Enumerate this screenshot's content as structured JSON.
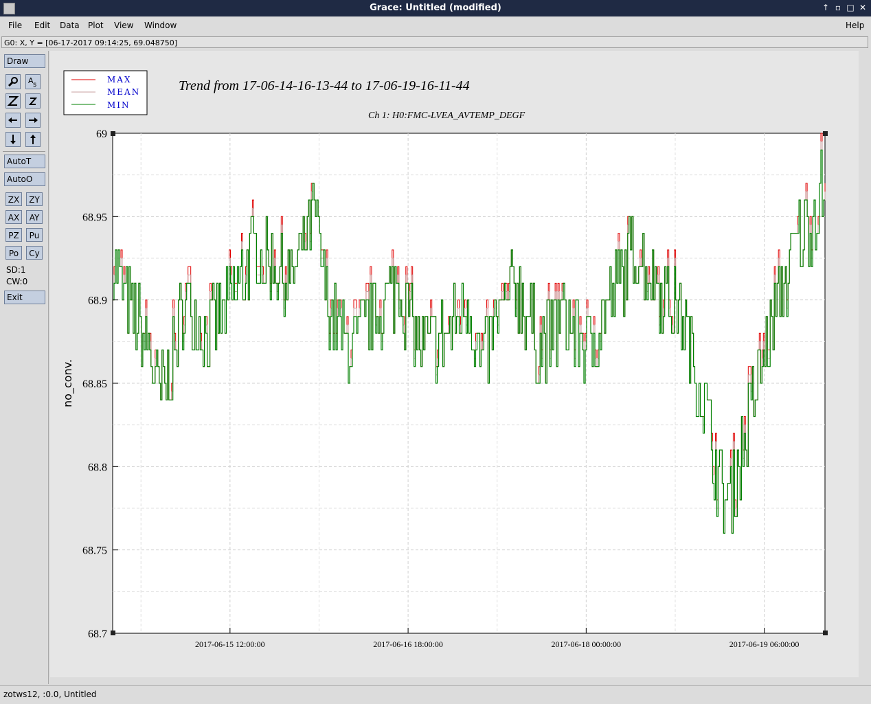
{
  "window": {
    "title": "Grace: Untitled (modified)",
    "controls": [
      "↑",
      "▫",
      "□",
      "✕"
    ]
  },
  "menubar": {
    "file": "File",
    "edit": "Edit",
    "data": "Data",
    "plot": "Plot",
    "view": "View",
    "window": "Window",
    "help": "Help"
  },
  "coord_readout": "G0: X, Y = [06-17-2017 09:14:25, 69.048750]",
  "toolbar": {
    "draw": "Draw",
    "zoom_icon": "magnifier-icon",
    "text_icon": "text-icon",
    "autoT": "AutoT",
    "autoO": "AutoO",
    "zx": "ZX",
    "zy": "ZY",
    "ax": "AX",
    "ay": "AY",
    "pz": "PZ",
    "pu": "Pu",
    "po": "Po",
    "cy": "Cy",
    "sd": "SD:1",
    "cw": "CW:0",
    "exit": "Exit"
  },
  "status": "zotws12, :0.0, Untitled",
  "chart_data": {
    "type": "line",
    "title": "Trend from 17-06-14-16-13-44 to 17-06-19-16-11-44",
    "subtitle": "Ch 1: H0:FMC-LVEA_AVTEMP_DEGF",
    "ylabel": "no_conv.",
    "xlabel": "",
    "ylim": [
      68.7,
      69.0
    ],
    "yticks": [
      "68.7",
      "68.75",
      "68.8",
      "68.85",
      "68.9",
      "68.95",
      "69"
    ],
    "xticks": [
      "2017-06-15 12:00:00",
      "2017-06-16 18:00:00",
      "2017-06-18 00:00:00",
      "2017-06-19 06:00:00"
    ],
    "xrange": [
      "2017-06-14 16:13:44",
      "2017-06-19 16:11:44"
    ],
    "grid": true,
    "legend_position": "top-left",
    "series": [
      {
        "name": "MAX",
        "color": "#e00000"
      },
      {
        "name": "MEAN",
        "color": "#c8a0a0"
      },
      {
        "name": "MIN",
        "color": "#008000"
      }
    ],
    "series_values_note": "",
    "min_profile": {
      "t_hours": [
        0,
        6,
        8,
        10,
        12,
        16,
        20,
        24,
        28,
        30,
        34,
        36,
        38,
        40,
        44,
        48,
        52,
        56,
        60,
        62,
        64,
        68,
        70,
        72,
        76,
        80,
        84,
        88,
        92,
        96,
        98,
        100,
        102,
        104,
        106,
        108,
        110,
        112,
        114,
        116,
        118,
        120
      ],
      "values": [
        68.92,
        68.87,
        68.84,
        68.86,
        68.9,
        68.88,
        68.9,
        68.93,
        68.92,
        68.91,
        68.95,
        68.9,
        68.88,
        68.87,
        68.89,
        68.91,
        68.87,
        68.88,
        68.9,
        68.86,
        68.88,
        68.91,
        68.89,
        68.87,
        68.89,
        68.87,
        68.9,
        68.93,
        68.91,
        68.89,
        68.86,
        68.83,
        68.79,
        68.78,
        68.81,
        68.84,
        68.87,
        68.9,
        68.92,
        68.94,
        68.95,
        68.97
      ]
    }
  },
  "colors": {
    "titlebar": "#1f2a44",
    "button": "#c4cfe0",
    "legend_text": "#0000cc"
  }
}
